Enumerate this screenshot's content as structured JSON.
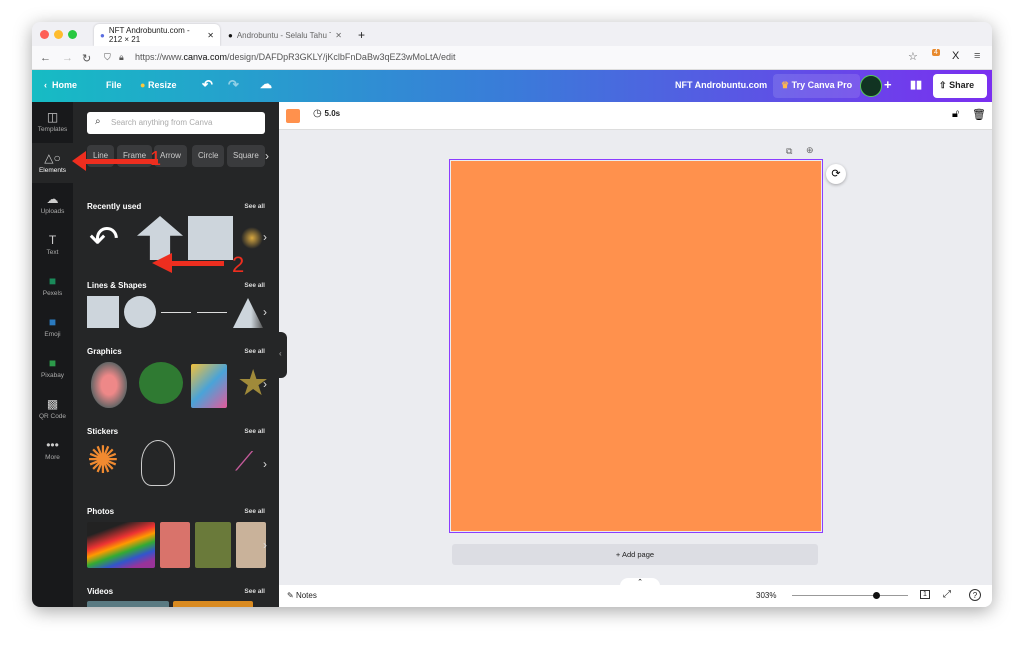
{
  "browser": {
    "tabs": [
      {
        "title": "NFT Androbuntu.com - 212 × 21",
        "active": true
      },
      {
        "title": "Androbuntu - Selalu Tahu Tekno",
        "active": false
      }
    ],
    "url_prefix": "https://www.",
    "url_domain": "canva.com",
    "url_path": "/design/DAFDpR3GKLY/jKclbFnDaBw3qEZ3wMoLtA/edit",
    "extension_badge": "4"
  },
  "header": {
    "home": "Home",
    "file": "File",
    "resize": "Resize",
    "doc_title": "NFT Androbuntu.com",
    "try_pro": "Try Canva Pro",
    "share": "Share",
    "gradient": [
      "#16bcc4",
      "#3a7bd9",
      "#7b2ff0"
    ]
  },
  "rail": [
    {
      "label": "Templates",
      "icon": "templates-icon"
    },
    {
      "label": "Elements",
      "icon": "elements-icon",
      "active": true
    },
    {
      "label": "Uploads",
      "icon": "upload-icon"
    },
    {
      "label": "Text",
      "icon": "text-icon"
    },
    {
      "label": "Pexels",
      "icon": "pexels-icon"
    },
    {
      "label": "Emoji",
      "icon": "emoji-icon"
    },
    {
      "label": "Pixabay",
      "icon": "pixabay-icon"
    },
    {
      "label": "QR Code",
      "icon": "qr-code-icon"
    },
    {
      "label": "More",
      "icon": "more-icon"
    }
  ],
  "panel": {
    "search_placeholder": "Search anything from Canva",
    "chips": [
      "Line",
      "Frame",
      "Arrow",
      "Circle",
      "Square"
    ],
    "sections": [
      {
        "title": "Recently used",
        "see_all": "See all"
      },
      {
        "title": "Lines & Shapes",
        "see_all": "See all"
      },
      {
        "title": "Graphics",
        "see_all": "See all"
      },
      {
        "title": "Stickers",
        "see_all": "See all"
      },
      {
        "title": "Photos",
        "see_all": "See all"
      },
      {
        "title": "Videos",
        "see_all": "See all"
      }
    ]
  },
  "annotations": [
    "1",
    "2"
  ],
  "toolbar": {
    "duration": "5.0s",
    "color": "#ff914d"
  },
  "canvas": {
    "page_color": "#ff914d",
    "add_page": "+ Add page"
  },
  "footer": {
    "notes": "Notes",
    "zoom": "303%",
    "zoom_slider": 0.72,
    "page_count": "1"
  }
}
